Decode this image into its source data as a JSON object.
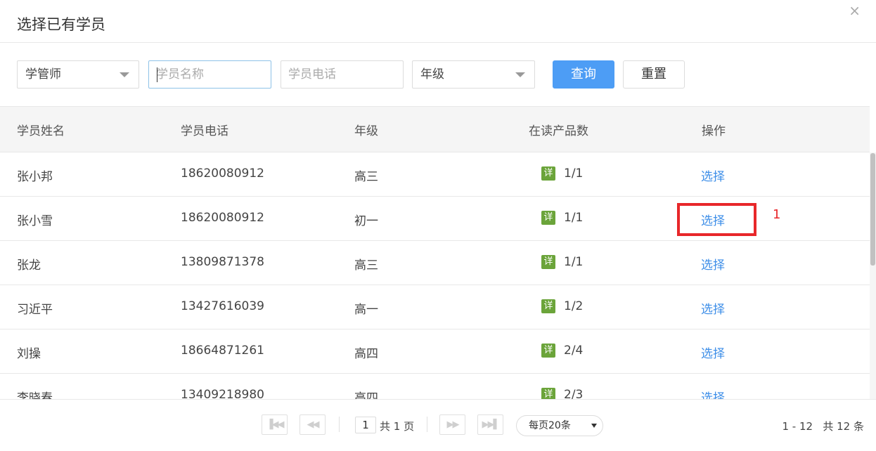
{
  "dialog": {
    "title": "选择已有学员",
    "close_glyph": "×"
  },
  "filters": {
    "manager_select": "学管师",
    "name_placeholder": "学员名称",
    "phone_placeholder": "学员电话",
    "grade_select": "年级",
    "search_label": "查询",
    "reset_label": "重置"
  },
  "table": {
    "columns": [
      "学员姓名",
      "学员电话",
      "年级",
      "在读产品数",
      "操作"
    ],
    "detail_badge": "详",
    "rows": [
      {
        "name": "张小邦",
        "phone": "18620080912",
        "grade": "高三",
        "products": "1/1",
        "action": "选择"
      },
      {
        "name": "张小雪",
        "phone": "18620080912",
        "grade": "初一",
        "products": "1/1",
        "action": "选择"
      },
      {
        "name": "张龙",
        "phone": "13809871378",
        "grade": "高三",
        "products": "1/1",
        "action": "选择"
      },
      {
        "name": "习近平",
        "phone": "13427616039",
        "grade": "高一",
        "products": "1/2",
        "action": "选择"
      },
      {
        "name": "刘操",
        "phone": "18664871261",
        "grade": "高四",
        "products": "2/4",
        "action": "选择"
      },
      {
        "name": "李晓春",
        "phone": "13409218980",
        "grade": "高四",
        "products": "2/3",
        "action": "选择"
      }
    ]
  },
  "annotation": {
    "label": "1",
    "color": "#e8272a"
  },
  "pagination": {
    "current_page": "1",
    "total_pages_text": "共 1 页",
    "page_size": "每页20条",
    "range_text": "1 - 12",
    "total_text": "共 12 条"
  },
  "colors": {
    "primary": "#4d9df5",
    "link": "#3d8ee8",
    "badge": "#6ba43a"
  },
  "icons": [
    "close-icon",
    "first-page-icon",
    "prev-page-icon",
    "next-page-icon",
    "last-page-icon",
    "dropdown-caret-icon",
    "detail-icon"
  ]
}
